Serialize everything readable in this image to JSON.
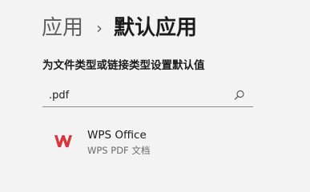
{
  "breadcrumb": {
    "parent": "应用",
    "separator": "›",
    "current": "默认应用"
  },
  "section": {
    "label": "为文件类型或链接类型设置默认值"
  },
  "search": {
    "value": ".pdf",
    "icon": "search-icon"
  },
  "app": {
    "name": "WPS Office",
    "description": "WPS PDF 文档",
    "icon": "wps-office-icon",
    "icon_color": "#d9363e"
  }
}
